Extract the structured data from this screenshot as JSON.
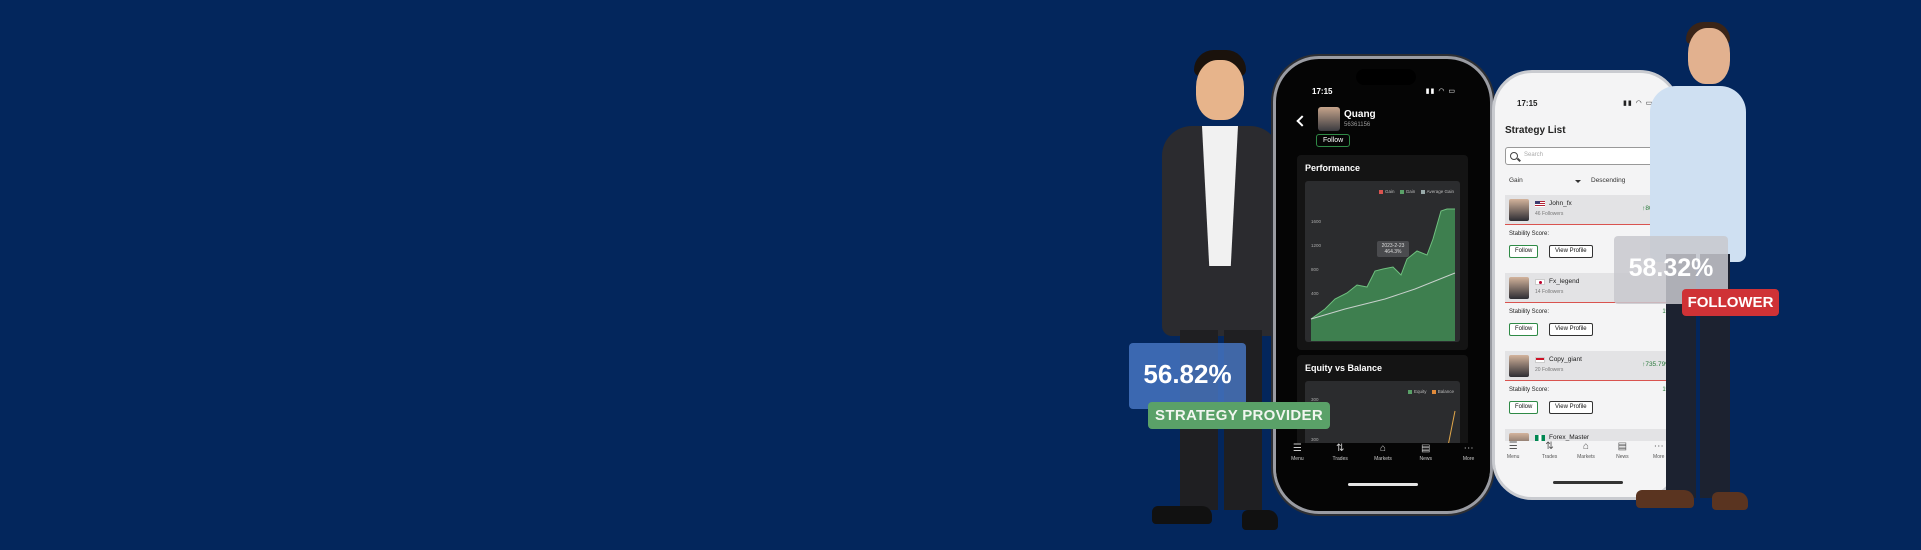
{
  "colors": {
    "background": "#03265c",
    "provider_badge": "#4878c4",
    "provider_label": "#5aa168",
    "follower_badge": "#c8c8ce",
    "follower_label": "#cf3236",
    "gain_green": "#2f8a46",
    "loss_red": "#d9534f"
  },
  "badges": {
    "provider_percent": "56.82%",
    "provider_label": "STRATEGY PROVIDER",
    "follower_percent": "58.32%",
    "follower_label": "FOLLOWER"
  },
  "phone_dark": {
    "time": "17:15",
    "profile": {
      "name": "Quang",
      "id": "56361156",
      "follow_label": "Follow"
    },
    "performance": {
      "title": "Performance",
      "legend": [
        "Gain",
        "Gain",
        "Average Gain"
      ],
      "ticks": [
        "1600",
        "1200",
        "800",
        "400"
      ],
      "tooltip_date": "2023-2-23",
      "tooltip_value": "464.3%"
    },
    "equity": {
      "title": "Equity vs Balance",
      "legend": [
        "Equity",
        "Balance"
      ],
      "ticks": [
        "300",
        "300"
      ]
    },
    "tabs": [
      {
        "icon": "menu-icon",
        "label": "Menu"
      },
      {
        "icon": "trades-icon",
        "label": "Trades"
      },
      {
        "icon": "markets-icon",
        "label": "Markets"
      },
      {
        "icon": "news-icon",
        "label": "News"
      },
      {
        "icon": "more-icon",
        "label": "More"
      }
    ]
  },
  "phone_light": {
    "time": "17:15",
    "title": "Strategy List",
    "search_placeholder": "Search",
    "sort_field": "Gain",
    "sort_order": "Descending",
    "rows": [
      {
        "name": "John_fx",
        "followers": "46 Followers",
        "gain": "↑809.76%",
        "stability": "Stability Score:",
        "stability_value": "",
        "follow": "Follow",
        "view": "View Profile",
        "flag": "us-flag-icon"
      },
      {
        "name": "Fx_legend",
        "followers": "14 Followers",
        "gain": "",
        "stability": "Stability Score:",
        "stability_value": "1%",
        "follow": "Follow",
        "view": "View Profile",
        "flag": "jp-flag-icon"
      },
      {
        "name": "Copy_giant",
        "followers": "20 Followers",
        "gain": "↑735.79%",
        "stability": "Stability Score:",
        "stability_value": "1%",
        "follow": "Follow",
        "view": "View Profile",
        "flag": "id-flag-icon"
      }
    ],
    "partial_row_name": "Forex_Master",
    "tabs": [
      {
        "icon": "menu-icon",
        "label": "Menu"
      },
      {
        "icon": "trades-icon",
        "label": "Trades"
      },
      {
        "icon": "markets-icon",
        "label": "Markets"
      },
      {
        "icon": "news-icon",
        "label": "News"
      },
      {
        "icon": "more-icon",
        "label": "More"
      }
    ]
  }
}
